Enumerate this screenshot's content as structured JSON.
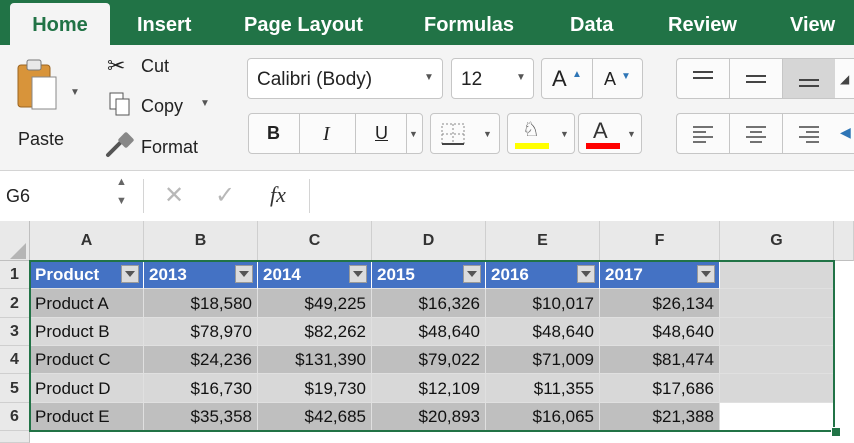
{
  "tabs": [
    "Home",
    "Insert",
    "Page Layout",
    "Formulas",
    "Data",
    "Review",
    "View"
  ],
  "clipboard": {
    "paste": "Paste",
    "cut": "Cut",
    "copy": "Copy",
    "format": "Format"
  },
  "font": {
    "name": "Calibri (Body)",
    "size": "12",
    "bold": "B",
    "italic": "I",
    "underline": "U",
    "grow": "A",
    "shrink": "A",
    "font_color_letter": "A"
  },
  "colors": {
    "highlight": "#ffff00",
    "font_color": "#ff0000",
    "header_fill": "#4472c4",
    "accent": "#217346"
  },
  "formula_bar": {
    "name_box": "G6",
    "fx": "fx",
    "formula": ""
  },
  "columns": [
    "A",
    "B",
    "C",
    "D",
    "E",
    "F",
    "G"
  ],
  "rows": [
    "1",
    "2",
    "3",
    "4",
    "5",
    "6"
  ],
  "table": {
    "headers": [
      "Product",
      "2013",
      "2014",
      "2015",
      "2016",
      "2017"
    ],
    "data": [
      [
        "Product A",
        "$18,580",
        "$49,225",
        "$16,326",
        "$10,017",
        "$26,134"
      ],
      [
        "Product B",
        "$78,970",
        "$82,262",
        "$48,640",
        "$48,640",
        "$48,640"
      ],
      [
        "Product C",
        "$24,236",
        "$131,390",
        "$79,022",
        "$71,009",
        "$81,474"
      ],
      [
        "Product D",
        "$16,730",
        "$19,730",
        "$12,109",
        "$11,355",
        "$17,686"
      ],
      [
        "Product E",
        "$35,358",
        "$42,685",
        "$20,893",
        "$16,065",
        "$21,388"
      ]
    ]
  }
}
